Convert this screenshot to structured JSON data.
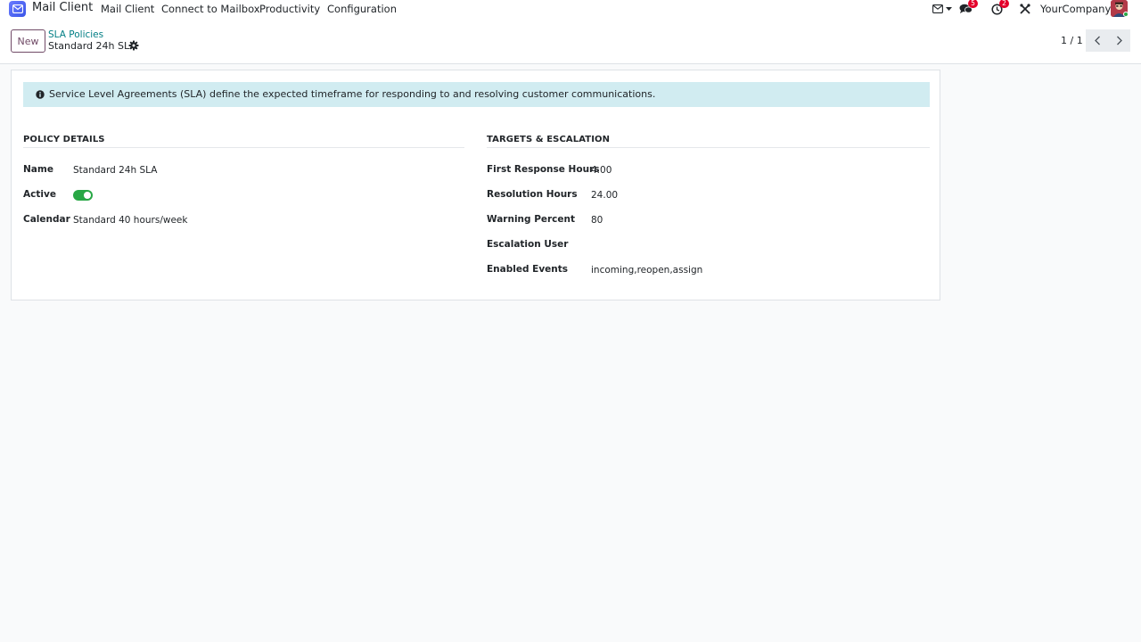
{
  "navbar": {
    "app_name": "Mail Client",
    "menu": [
      "Mail Client",
      "Connect to Mailbox",
      "Productivity",
      "Configuration"
    ],
    "messages_badge": "5",
    "activities_badge": "2",
    "company": "YourCompany",
    "icons": [
      "app-mail-icon",
      "mail-dropdown-icon",
      "chat-bubbles-icon",
      "clock-activity-icon",
      "debug-tools-icon",
      "user-avatar"
    ]
  },
  "control_panel": {
    "new_label": "New",
    "breadcrumb": "SLA Policies",
    "record_title": "Standard 24h SLA",
    "pager": "1 / 1"
  },
  "form": {
    "info_text": "Service Level Agreements (SLA) define the expected timeframe for responding to and resolving customer communications.",
    "policy_details": {
      "title": "POLICY DETAILS",
      "fields": {
        "name_label": "Name",
        "name_value": "Standard 24h SLA",
        "active_label": "Active",
        "active_value": true,
        "calendar_label": "Calendar",
        "calendar_value": "Standard 40 hours/week"
      }
    },
    "targets": {
      "title": "TARGETS & ESCALATION",
      "fields": {
        "first_response_label": "First Response Hours",
        "first_response_value": "4.00",
        "resolution_label": "Resolution Hours",
        "resolution_value": "24.00",
        "warning_label": "Warning Percent",
        "warning_value": "80",
        "escalation_label": "Escalation User",
        "escalation_value": "",
        "events_label": "Enabled Events",
        "events_value": "incoming,reopen,assign"
      }
    }
  },
  "colors": {
    "brand": "#714b67",
    "link": "#017e84",
    "toggle_on": "#28a745",
    "badge": "#e4002b",
    "info_bg": "#d1ecf1"
  }
}
